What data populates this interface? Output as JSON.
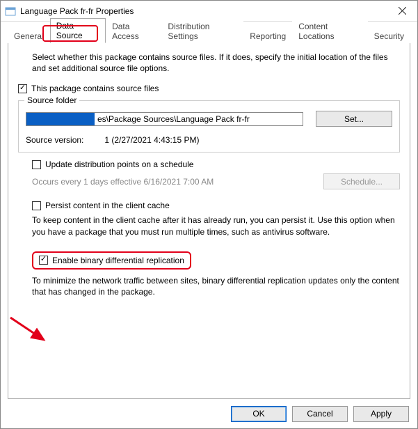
{
  "window": {
    "title": "Language Pack fr-fr Properties"
  },
  "tabs": {
    "t0": "General",
    "t1": "Data Source",
    "t2": "Data Access",
    "t3": "Distribution Settings",
    "t4": "Reporting",
    "t5": "Content Locations",
    "t6": "Security"
  },
  "panel": {
    "desc": "Select whether this package contains source files. If it does, specify the initial location of the files and set additional source file options.",
    "contains_label": "This package contains source files",
    "groupbox_title": "Source folder",
    "path_visible": "es\\Package Sources\\Language Pack fr-fr",
    "set_button": "Set...",
    "source_version_label": "Source version:",
    "source_version_value": "1 (2/27/2021 4:43:15 PM)",
    "update_label": "Update distribution points on a schedule",
    "update_occurs": "Occurs every 1 days effective 6/16/2021 7:00 AM",
    "schedule_button": "Schedule...",
    "persist_label": "Persist content in the client cache",
    "persist_desc": "To keep content in the client cache after it has already run, you can persist it. Use this option when you have  a package that you must run multiple times, such as antivirus software.",
    "bdr_label": "Enable binary differential replication",
    "bdr_desc": "To minimize the network traffic between sites, binary differential replication updates only the content that has changed in the package."
  },
  "footer": {
    "ok": "OK",
    "cancel": "Cancel",
    "apply": "Apply"
  }
}
